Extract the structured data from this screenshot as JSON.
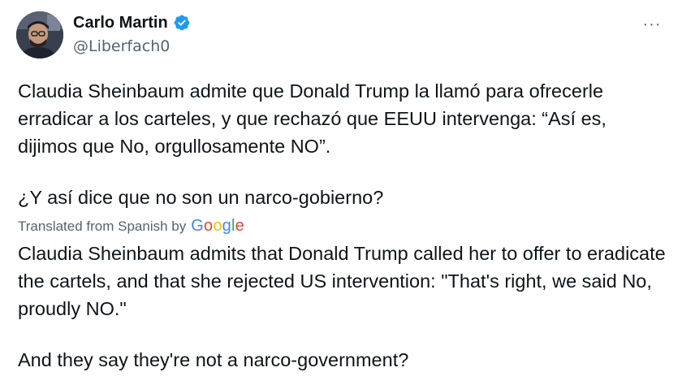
{
  "author": {
    "display_name": "Carlo Martin",
    "handle": "@Liberfach0",
    "verified_icon": "verified-badge-icon",
    "avatar_icon": "user-avatar"
  },
  "more_menu": {
    "icon": "more-dots-icon",
    "label": "···"
  },
  "tweet": {
    "original_paragraph_1": "Claudia Sheinbaum admite que Donald Trump la llamó para ofrecerle erradicar a los carteles, y que rechazó que EEUU intervenga: “Así es, dijimos que No, orgullosamente NO”.",
    "original_paragraph_2": "¿Y así dice que no son un narco-gobierno?",
    "translation_label": "Translated from Spanish by",
    "translation_provider": "Google",
    "translated_paragraph_1": "Claudia Sheinbaum admits that Donald Trump called her to offer to eradicate the cartels, and that she rejected US intervention: \"That's right, we said No, proudly NO.\"",
    "translated_paragraph_2": "And they say they're not a narco-government?"
  },
  "colors": {
    "text": "#0f1419",
    "secondary": "#536471",
    "verified": "#1d9bf0"
  }
}
